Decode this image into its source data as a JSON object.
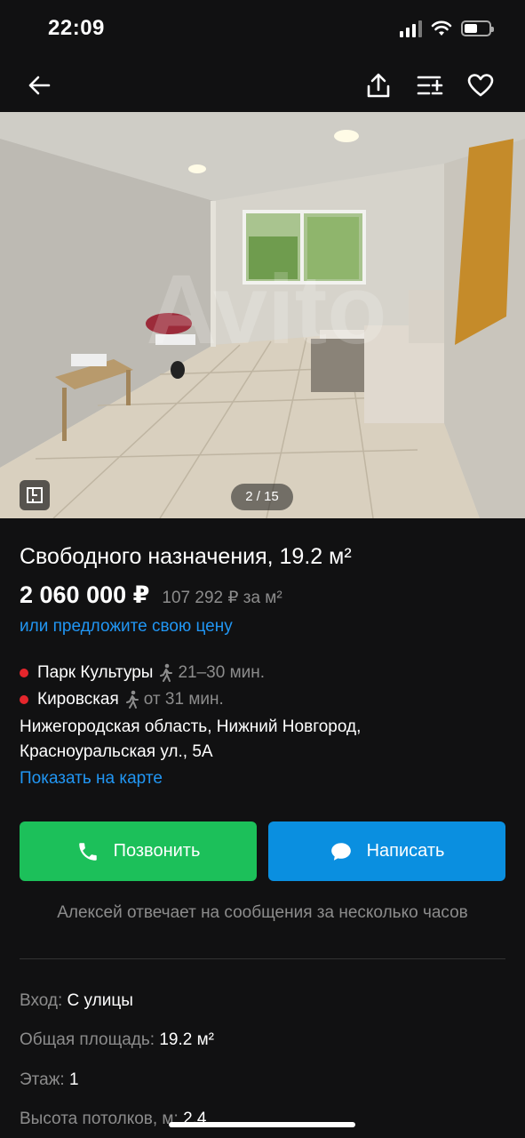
{
  "status": {
    "time": "22:09",
    "battery_level": 0.55
  },
  "nav": {
    "back_icon": "arrow-left-icon",
    "share_icon": "share-icon",
    "compare_icon": "compare-list-icon",
    "favorite_icon": "heart-icon"
  },
  "photo": {
    "counter": "2 / 15",
    "watermark": "Avito"
  },
  "listing": {
    "title": "Свободного назначения, 19.2 м²",
    "price": "2 060 000 ₽",
    "price_per_m2": "107 292 ₽ за м²",
    "offer_link": "или предложите свою цену"
  },
  "location": {
    "metro": [
      {
        "name": "Парк Культуры",
        "time": "21–30 мин.",
        "color": "#e5262c"
      },
      {
        "name": "Кировская",
        "time": "от 31 мин.",
        "color": "#e5262c"
      }
    ],
    "address_line1": "Нижегородская область, Нижний Новгород,",
    "address_line2": "Красноуральская ул., 5А",
    "map_link": "Показать на карте"
  },
  "actions": {
    "call_label": "Позвонить",
    "message_label": "Написать",
    "call_color": "#1cc05a",
    "message_color": "#0a8fe0"
  },
  "seller": {
    "reply_note": "Алексей отвечает на сообщения за несколько часов"
  },
  "params": [
    {
      "key": "Вход:",
      "value": "С улицы"
    },
    {
      "key": "Общая площадь:",
      "value": "19.2 м²"
    },
    {
      "key": "Этаж:",
      "value": "1"
    },
    {
      "key": "Высота потолков, м:",
      "value": "2.4"
    }
  ]
}
